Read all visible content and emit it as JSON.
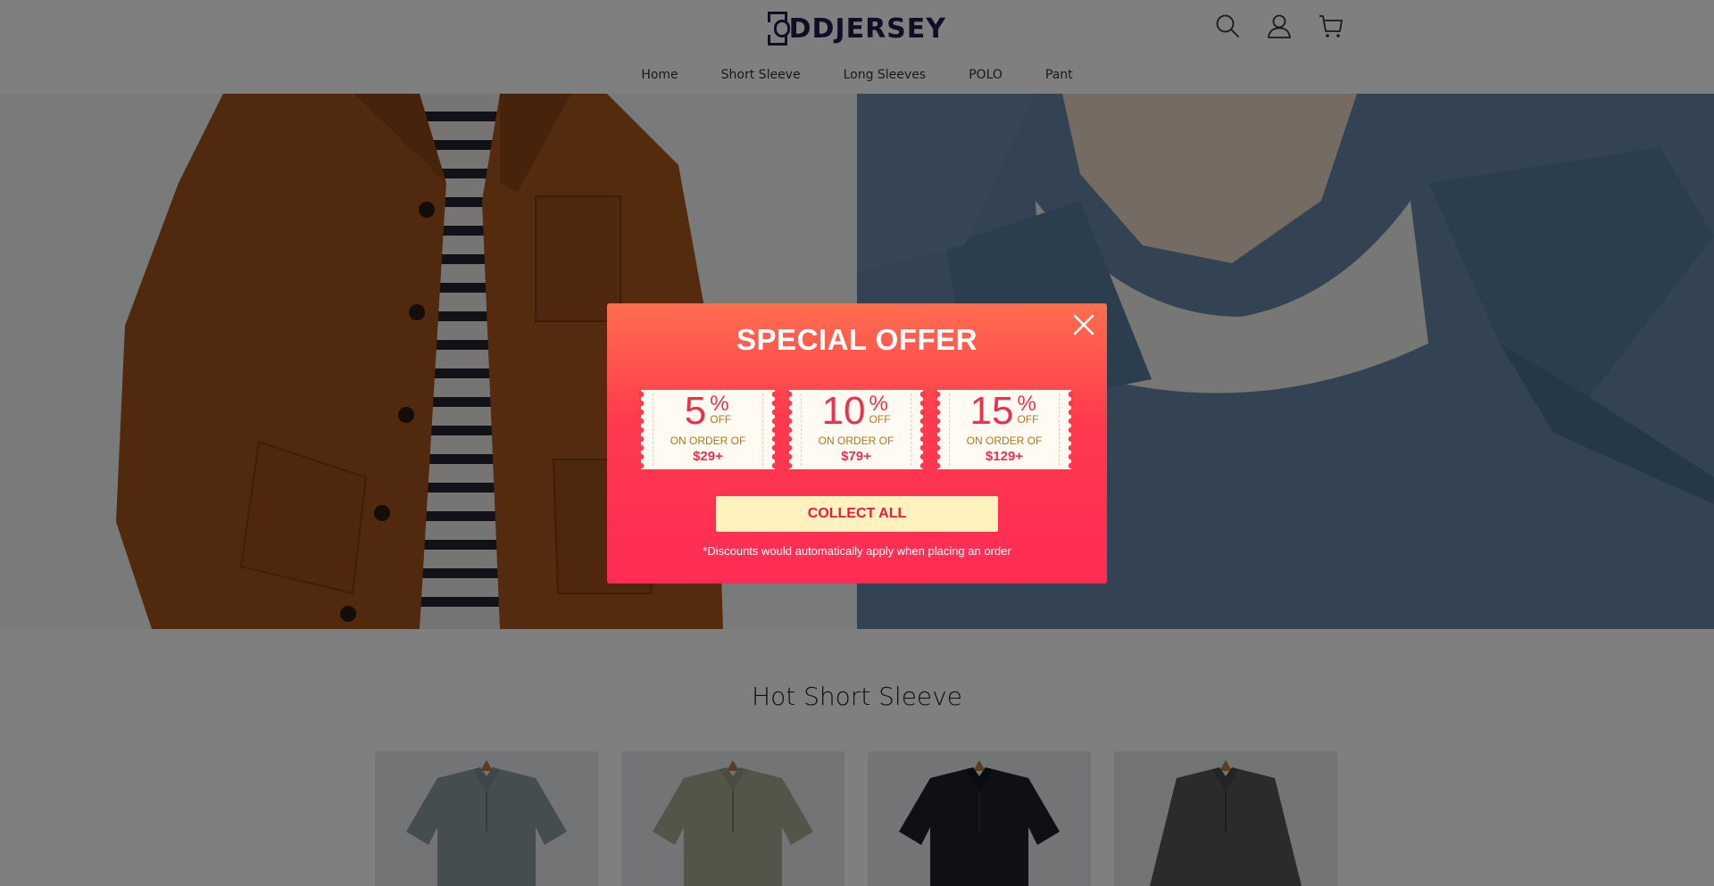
{
  "brand": {
    "logo_text": "DDJERSEY",
    "logo_name": "oddjersey-logo"
  },
  "header": {
    "icons": [
      "search-icon",
      "account-icon",
      "cart-icon"
    ]
  },
  "nav": {
    "items": [
      {
        "label": "Home"
      },
      {
        "label": "Short Sleeve"
      },
      {
        "label": "Long Sleeves"
      },
      {
        "label": "POLO"
      },
      {
        "label": "Pant"
      }
    ]
  },
  "section": {
    "title": "Hot Short Sleeve"
  },
  "modal": {
    "title": "SPECIAL OFFER",
    "close_icon": "close-icon",
    "coupons": [
      {
        "value": "5",
        "percent": "%",
        "off": "OFF",
        "order_label": "ON ORDER OF",
        "threshold": "$29+"
      },
      {
        "value": "10",
        "percent": "%",
        "off": "OFF",
        "order_label": "ON ORDER OF",
        "threshold": "$79+"
      },
      {
        "value": "15",
        "percent": "%",
        "off": "OFF",
        "order_label": "ON ORDER OF",
        "threshold": "$129+"
      }
    ],
    "button_label": "COLLECT ALL",
    "note": "*Discounts would automatically apply when placing an order"
  },
  "colors": {
    "brand_navy": "#1e1c4a",
    "modal_red": "#ff2b55",
    "coupon_red": "#e9324d",
    "button_yellow": "#fff2bf"
  }
}
